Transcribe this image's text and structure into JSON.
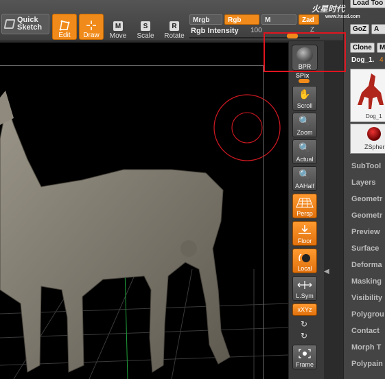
{
  "toolbar": {
    "quick_sketch": "Quick Sketch",
    "edit": "Edit",
    "draw": "Draw",
    "move": "Move",
    "move_key": "M",
    "scale": "Scale",
    "scale_key": "S",
    "rotate": "Rotate",
    "rotate_key": "R",
    "mrgb": "Mrgb",
    "rgb": "Rgb",
    "m": "M",
    "zadd": "Zad",
    "rgb_intensity_label": "Rgb Intensity",
    "rgb_intensity_value": "100",
    "rgb_intensity_level": 1.0,
    "z_label": "Z"
  },
  "dock": {
    "bpr": "BPR",
    "spix": "SPix",
    "scroll": "Scroll",
    "zoom": "Zoom",
    "actual": "Actual",
    "aahalf": "AAHalf",
    "persp": "Persp",
    "floor": "Floor",
    "local": "Local",
    "lsym": "L.Sym",
    "xyz": "xXYz",
    "frame": "Frame"
  },
  "right_panel": {
    "load_tool": "Load Too",
    "goz": "GoZ",
    "all": "A",
    "clone": "Clone",
    "make": "M",
    "tool_name": "Dog_1.",
    "tool_name_suffix": "4",
    "thumb_label": "Dog_1",
    "sphere_label": "ZSpher",
    "menu": [
      "SubTool",
      "Layers",
      "Geometr",
      "Geometr",
      "Preview",
      "Surface",
      "Deforma",
      "Masking",
      "Visibility",
      "Polygrou",
      "Contact",
      "Morph T",
      "Polypain"
    ]
  },
  "watermark": {
    "text": "火星时代",
    "url": "www.hxsd.com"
  },
  "colors": {
    "accent": "#f08a1a",
    "highlight_box": "#e0151f",
    "viewport_bg": "#000000",
    "model": "#8a8578"
  }
}
